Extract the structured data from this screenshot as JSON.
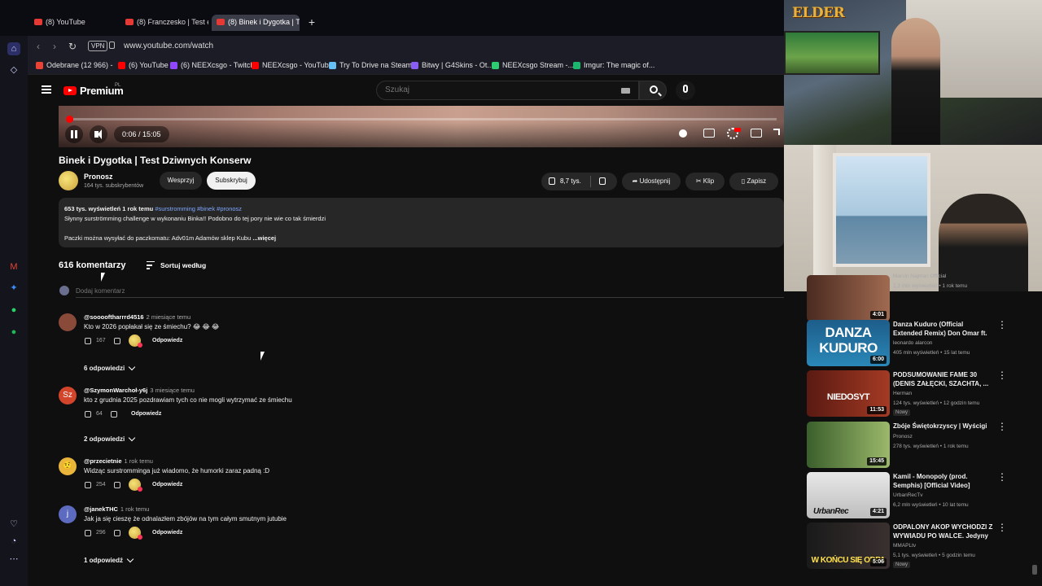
{
  "browser": {
    "tabs": [
      {
        "label": "(8) YouTube"
      },
      {
        "label": "(8) Franczesko | Test e-pa"
      },
      {
        "label": "(8) Binek i Dygotka | T"
      }
    ],
    "new_tab_symbol": "+",
    "vpn_label": "VPN",
    "url": "www.youtube.com/watch",
    "bookmarks": [
      {
        "label": "Odebrane (12 966) -",
        "color": "#ea4335"
      },
      {
        "label": "(6) YouTube",
        "color": "#ff0000"
      },
      {
        "label": "(6) NEEXcsgo - Twitch",
        "color": "#9146ff"
      },
      {
        "label": "NEEXcsgo - YouTube",
        "color": "#ff0000"
      },
      {
        "label": "Try To Drive na Steam",
        "color": "#66c0f4"
      },
      {
        "label": "Bitwy | G4Skins - Ot...",
        "color": "#8a5cf6"
      },
      {
        "label": "NEEXcsgo Stream -...",
        "color": "#2ecc71"
      },
      {
        "label": "Imgur: The magic of...",
        "color": "#1bb76e"
      }
    ]
  },
  "youtube": {
    "brand": "Premium",
    "region": "PL",
    "search_placeholder": "Szukaj"
  },
  "player": {
    "time": "0:06 / 15:05",
    "progress_fraction": 0.0066
  },
  "video": {
    "title": "Binek i Dygotka | Test Dziwnych Konserw",
    "channel": "Pronosz",
    "subscribers": "164 tys. subskrybentów",
    "support_label": "Wesprzyj",
    "subscribe_label": "Subskrybuj",
    "likes": "8,7 tys.",
    "share_label": "Udostępnij",
    "clip_label": "Klip",
    "save_label": "Zapisz"
  },
  "description": {
    "meta": "653 tys. wyświetleń  1 rok temu",
    "tags": "#surstromming #binek #pronosz",
    "line1": "Słynny surströmming challenge w wykonaniu Binka!! Podobno do tej pory nie wie co tak śmierdzi",
    "line2": "Paczki można wysyłać do paczkomatu: Adv01m Adamów sklep Kubu",
    "more": "...więcej"
  },
  "comments": {
    "count_label": "616 komentarzy",
    "sort_label": "Sortuj według",
    "add_placeholder": "Dodaj komentarz",
    "reply_label": "Odpowiedz",
    "items": [
      {
        "author": "@sooooftharrrd4516",
        "time": "2 miesiące temu",
        "text": "Kto w 2026 popłakał się ze śmiechu? 😂 😂 😂",
        "likes": "167",
        "replies": "6 odpowiedzi",
        "avatar_color": "#8a4a3a",
        "avatar_letter": ""
      },
      {
        "author": "@SzymonWarchoł-y6j",
        "time": "3 miesiące temu",
        "text": "kto z grudnia 2025 pozdrawiam tych co nie mogli wytrzymać ze śmiechu",
        "likes": "64",
        "replies": "2 odpowiedzi",
        "avatar_color": "#d2452b",
        "avatar_letter": "Sz"
      },
      {
        "author": "@przecietnie",
        "time": "1 rok temu",
        "text": "Widząc surstromminga już wiadomo, że humorki zaraz padną :D",
        "likes": "254",
        "replies": "",
        "avatar_color": "#e9b53a",
        "avatar_letter": "🤨"
      },
      {
        "author": "@janekTHC",
        "time": "1 rok temu",
        "text": "Jak ja się cieszę że odnalazłem zbójów na tym całym smutnym jutubie",
        "likes": "296",
        "replies": "1 odpowiedź",
        "avatar_color": "#5c6bc0",
        "avatar_letter": "j"
      }
    ]
  },
  "webcam": {
    "logo_text": "ELDER"
  },
  "recommendations": {
    "partial_top": {
      "channel": "Marcin Najman Official",
      "meta": "1,3 mln wyświetleń • 1 rok temu",
      "duration": "4:01"
    },
    "items": [
      {
        "title": "Danza Kuduro (Official Extended Remix) Don Omar ft. Lucenzo, ...",
        "channel": "leonardo alarcon",
        "meta": "405 mln wyświetleń • 15 lat temu",
        "duration": "6:00",
        "thumb_text": "DANZA KUDURO",
        "thumb_colors": [
          "#1d5d8a",
          "#2a88b8"
        ],
        "badge": ""
      },
      {
        "title": "PODSUMOWANIE FAME 30 (DENIS ZAŁĘCKI, SZACHTA, ...",
        "channel": "Herman",
        "meta": "124 tys. wyświetleń • 12 godzin temu",
        "duration": "11:53",
        "thumb_text": "NIEDOSYT",
        "thumb_colors": [
          "#5a1a12",
          "#a43a24"
        ],
        "badge": "Nowy"
      },
      {
        "title": "Zbóje Świętokrzyscy | Wyścigi",
        "channel": "Pronosz",
        "meta": "278 tys. wyświetleń • 1 rok temu",
        "duration": "15:45",
        "thumb_text": "",
        "thumb_colors": [
          "#3b5f2c",
          "#9bb86a"
        ],
        "badge": ""
      },
      {
        "title": "Kamil - Monopoly (prod. Semphis) [Official Video]",
        "channel": "UrbanRecTv",
        "meta": "6,2 mln wyświetleń • 10 lat temu",
        "duration": "4:21",
        "thumb_text": "UrbanRec",
        "thumb_colors": [
          "#c9c9c9",
          "#f1f1f1"
        ],
        "badge": ""
      },
      {
        "title": "ODPALONY AKOP WYCHODZI Z WYWIADU PO WALCE. Jedyny ...",
        "channel": "MMAPLtv",
        "meta": "5,1 tys. wyświetleń • 5 godzin temu",
        "duration": "5:06",
        "thumb_text": "W KOŃCU SIĘ ODPA",
        "thumb_colors": [
          "#1a1a1a",
          "#3a3030"
        ],
        "badge": "Nowy"
      }
    ]
  }
}
